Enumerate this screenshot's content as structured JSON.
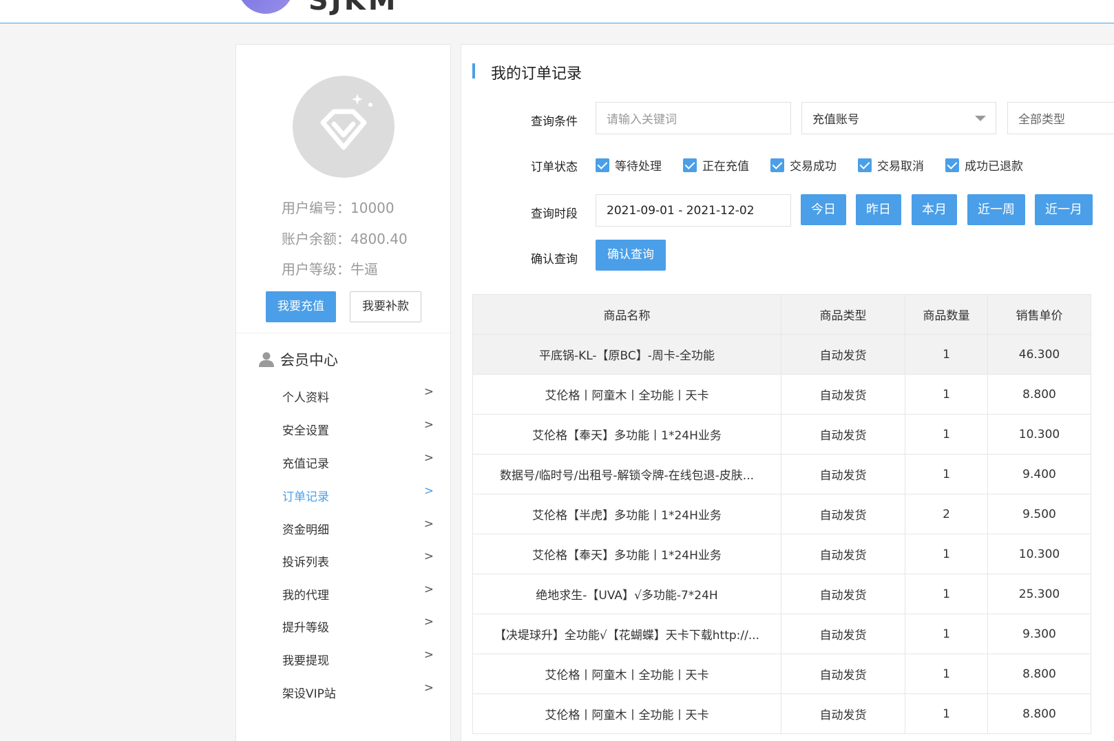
{
  "brand": {
    "logo_text": "SJKM"
  },
  "user": {
    "id_line": "用户编号：10000",
    "balance_line": "账户余额：4800.40",
    "level_line": "用户等级：牛逼",
    "recharge_button": "我要充值",
    "supplement_button": "我要补款"
  },
  "member_center": {
    "title": "会员中心",
    "items": [
      {
        "label": "个人资料",
        "active": false
      },
      {
        "label": "安全设置",
        "active": false
      },
      {
        "label": "充值记录",
        "active": false
      },
      {
        "label": "订单记录",
        "active": true
      },
      {
        "label": "资金明细",
        "active": false
      },
      {
        "label": "投诉列表",
        "active": false
      },
      {
        "label": "我的代理",
        "active": false
      },
      {
        "label": "提升等级",
        "active": false
      },
      {
        "label": "我要提现",
        "active": false
      },
      {
        "label": "架设VIP站",
        "active": false
      }
    ],
    "arrow": ">"
  },
  "main": {
    "title": "我的订单记录",
    "query": {
      "label": "查询条件",
      "keyword_placeholder": "请输入关键词",
      "field_select": "充值账号",
      "type_select": "全部类型"
    },
    "status": {
      "label": "订单状态",
      "options": [
        "等待处理",
        "正在充值",
        "交易成功",
        "交易取消",
        "成功已退款"
      ]
    },
    "period": {
      "label": "查询时段",
      "range": "2021-09-01 - 2021-12-02",
      "buttons": [
        "今日",
        "昨日",
        "本月",
        "近一周",
        "近一月"
      ]
    },
    "confirm": {
      "label": "确认查询",
      "button": "确认查询"
    },
    "table": {
      "headers": [
        "商品名称",
        "商品类型",
        "商品数量",
        "销售单价"
      ],
      "rows": [
        [
          "平底锅-KL-【原BC】-周卡-全功能",
          "自动发货",
          "1",
          "46.300"
        ],
        [
          "艾伦格丨阿童木丨全功能丨天卡",
          "自动发货",
          "1",
          "8.800"
        ],
        [
          "艾伦格【奉天】多功能丨1*24H业务",
          "自动发货",
          "1",
          "10.300"
        ],
        [
          "数据号/临时号/出租号-解锁令牌-在线包退-皮肤...",
          "自动发货",
          "1",
          "9.400"
        ],
        [
          "艾伦格【半虎】多功能丨1*24H业务",
          "自动发货",
          "2",
          "9.500"
        ],
        [
          "艾伦格【奉天】多功能丨1*24H业务",
          "自动发货",
          "1",
          "10.300"
        ],
        [
          "绝地求生-【UVA】√多功能-7*24H",
          "自动发货",
          "1",
          "25.300"
        ],
        [
          "【决堤球升】全功能√【花蝴蝶】天卡下载http://...",
          "自动发货",
          "1",
          "9.300"
        ],
        [
          "艾伦格丨阿童木丨全功能丨天卡",
          "自动发货",
          "1",
          "8.800"
        ],
        [
          "艾伦格丨阿童木丨全功能丨天卡",
          "自动发货",
          "1",
          "8.800"
        ]
      ]
    }
  },
  "colors": {
    "accent": "#4a9fe8",
    "header_bg": "#f2f2f2",
    "muted_text": "#999999"
  }
}
